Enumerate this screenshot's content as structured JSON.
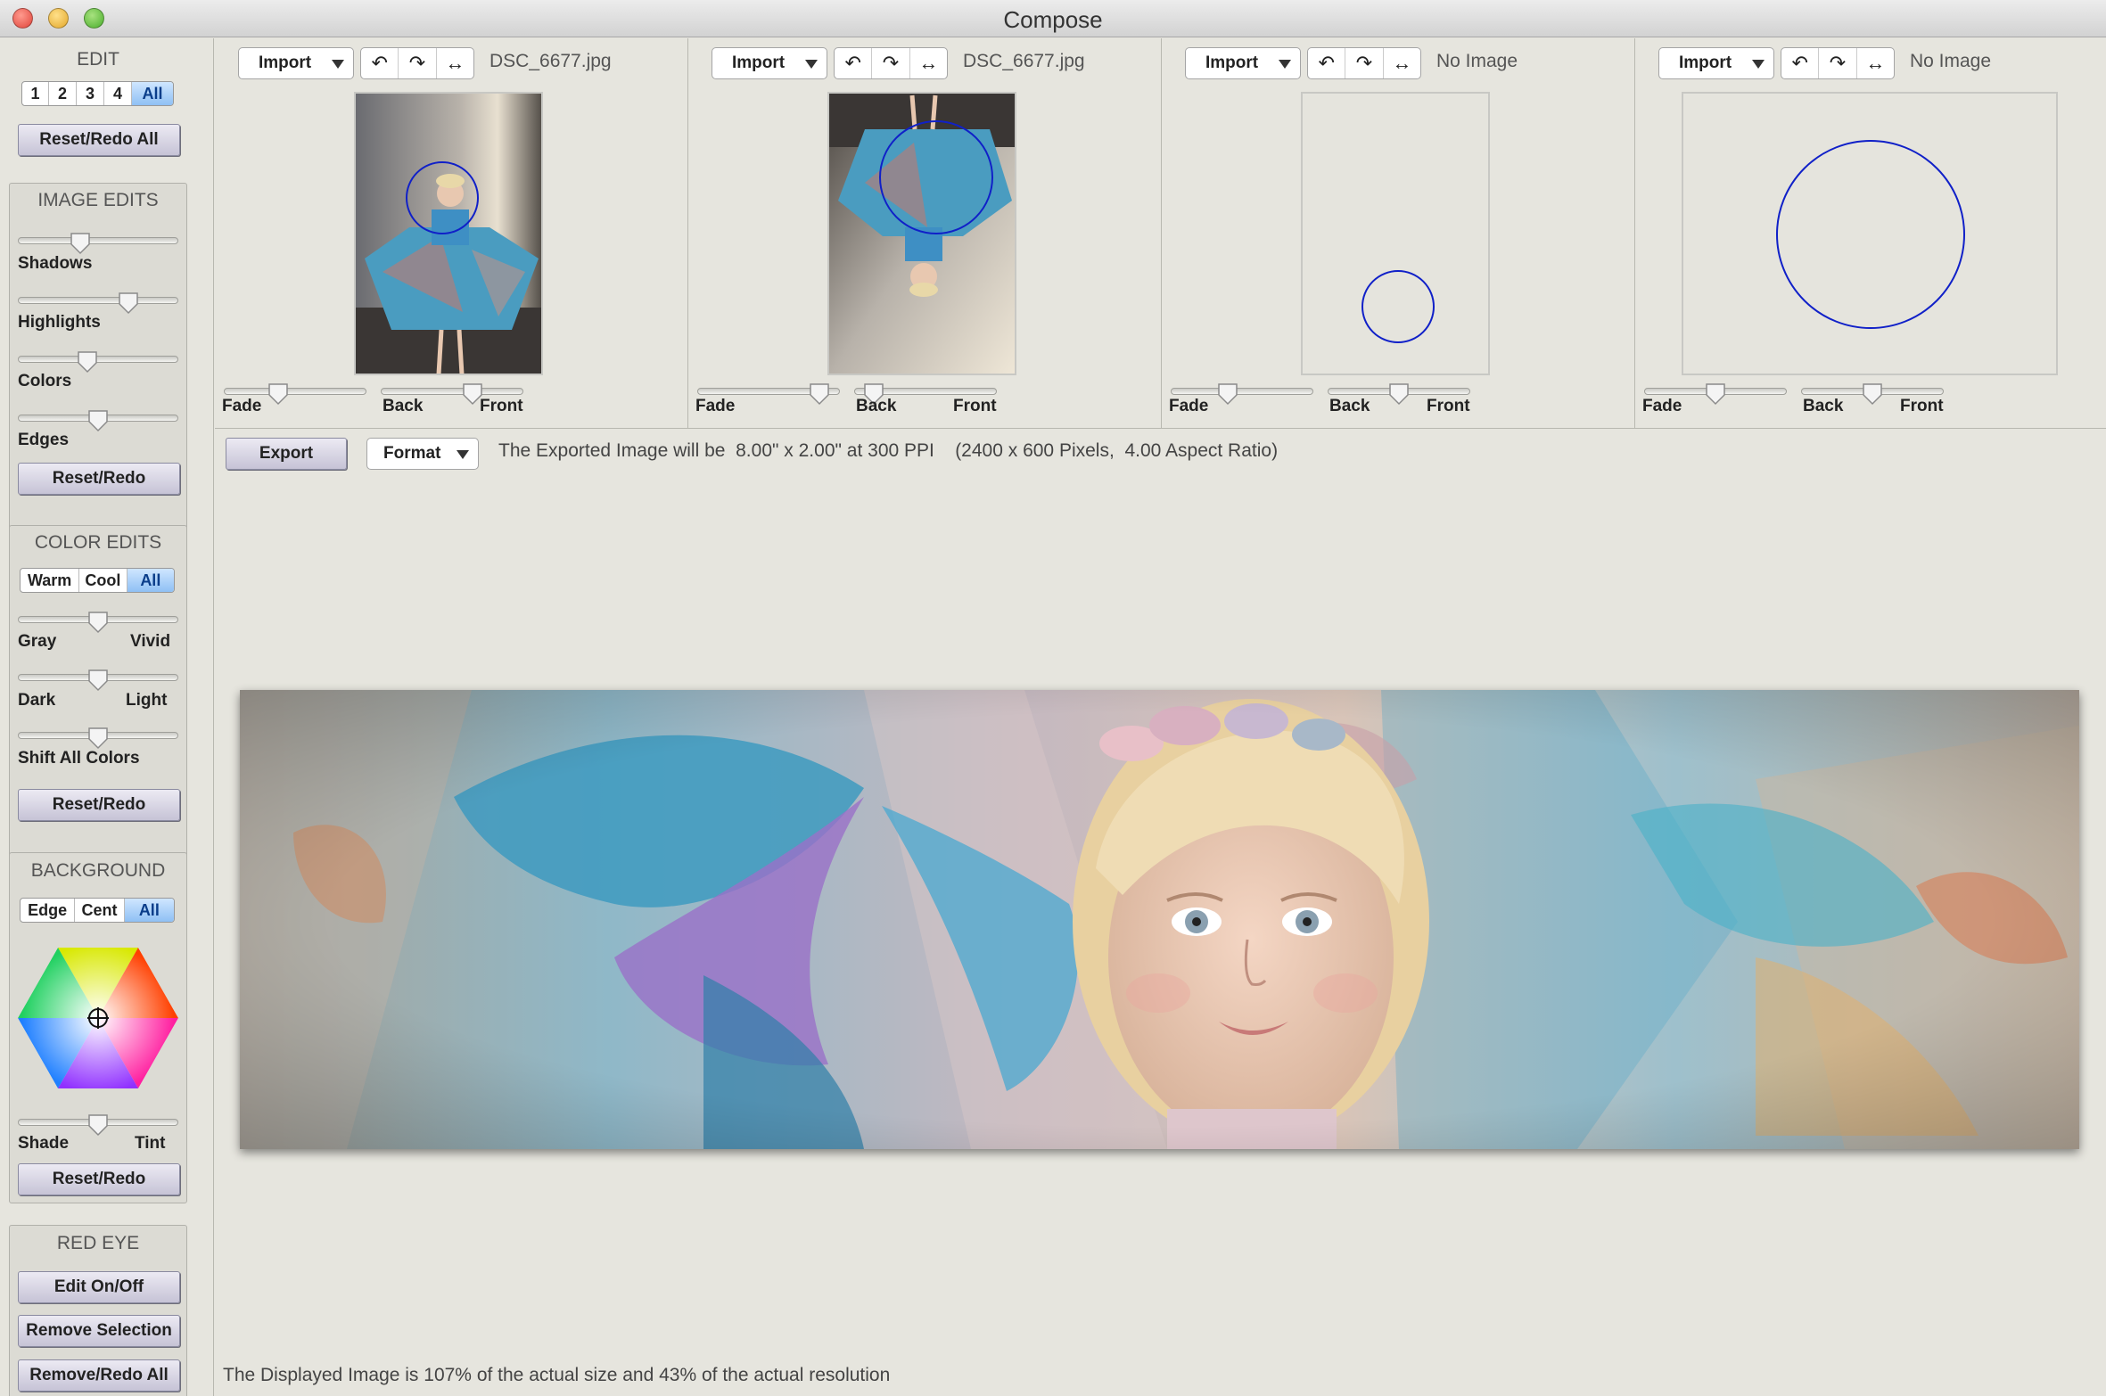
{
  "window": {
    "title": "Compose"
  },
  "sidebar": {
    "edit": {
      "title": "EDIT",
      "tabs": [
        "1",
        "2",
        "3",
        "4",
        "All"
      ],
      "selected_tab": "All",
      "reset_label": "Reset/Redo All"
    },
    "image_edits": {
      "title": "IMAGE EDITS",
      "sliders": [
        {
          "label": "Shadows",
          "value": 0.37
        },
        {
          "label": "Highlights",
          "value": 0.72
        },
        {
          "label": "Colors",
          "value": 0.42
        },
        {
          "label": "Edges",
          "value": 0.5
        }
      ],
      "reset_label": "Reset/Redo"
    },
    "color_edits": {
      "title": "COLOR EDITS",
      "tabs": [
        "Warm",
        "Cool",
        "All"
      ],
      "selected_tab": "All",
      "sliders": [
        {
          "left": "Gray",
          "right": "Vivid",
          "value": 0.5
        },
        {
          "left": "Dark",
          "right": "Light",
          "value": 0.5
        },
        {
          "left": "Shift All Colors",
          "right": "",
          "value": 0.5
        }
      ],
      "reset_label": "Reset/Redo"
    },
    "background": {
      "title": "BACKGROUND",
      "tabs": [
        "Edge",
        "Cent",
        "All"
      ],
      "selected_tab": "All",
      "slider": {
        "left": "Shade",
        "right": "Tint",
        "value": 0.5
      },
      "reset_label": "Reset/Redo"
    },
    "red_eye": {
      "title": "RED EYE",
      "buttons": [
        "Edit On/Off",
        "Remove Selection",
        "Remove/Redo All"
      ]
    }
  },
  "panels": [
    {
      "import_label": "Import",
      "file": "DSC_6677.jpg",
      "fade_label": "Fade",
      "back_label": "Back",
      "front_label": "Front",
      "fade_value": 0.36,
      "depth_value": 0.67
    },
    {
      "import_label": "Import",
      "file": "DSC_6677.jpg",
      "fade_label": "Fade",
      "back_label": "Back",
      "front_label": "Front",
      "fade_value": 0.92,
      "depth_value": 0.07
    },
    {
      "import_label": "Import",
      "file": "No Image",
      "fade_label": "Fade",
      "back_label": "Back",
      "front_label": "Front",
      "fade_value": 0.38,
      "depth_value": 0.5
    },
    {
      "import_label": "Import",
      "file": "No Image",
      "fade_label": "Fade",
      "back_label": "Back",
      "front_label": "Front",
      "fade_value": 0.5,
      "depth_value": 0.5
    }
  ],
  "toolbar": {
    "export_label": "Export",
    "format_label": "Format",
    "export_info": "The Exported Image will be  8.00\" x 2.00\" at 300 PPI    (2400 x 600 Pixels,  4.00 Aspect Ratio)"
  },
  "status": {
    "text": "The Displayed Image is 107% of the actual size and 43% of the actual resolution"
  },
  "colors": {
    "selected_segment": "#8fc0f4",
    "circle_outline": "#1020c8",
    "button_face": "#c6c3d6"
  },
  "icons": {
    "rotate_left": "↶",
    "rotate_right": "↷",
    "flip": "↔",
    "dropdown": "chevron-down"
  }
}
